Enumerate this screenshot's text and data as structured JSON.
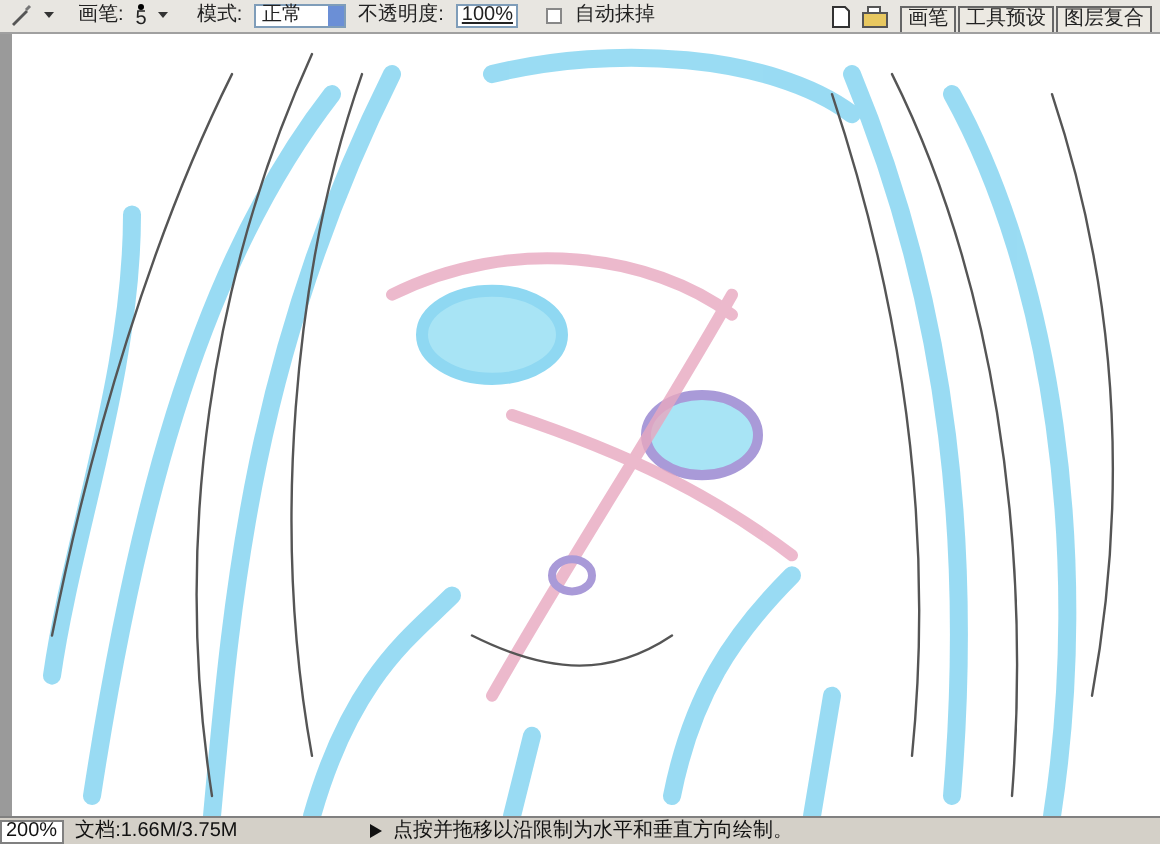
{
  "options_bar": {
    "brush_label": "画笔:",
    "brush_size": "5",
    "mode_label": "模式:",
    "mode_value": "正常",
    "opacity_label": "不透明度:",
    "opacity_value": "100%",
    "auto_erase": {
      "label": "自动抹掉",
      "checked": false
    }
  },
  "palette_tabs": [
    {
      "label": "画笔",
      "selected": false
    },
    {
      "label": "工具预设",
      "selected": false
    },
    {
      "label": "图层复合",
      "selected": false
    }
  ],
  "status_bar": {
    "zoom": "200%",
    "document": "文档:1.66M/3.75M",
    "hint": "点按并拖移以沿限制为水平和垂直方向绘制。"
  }
}
